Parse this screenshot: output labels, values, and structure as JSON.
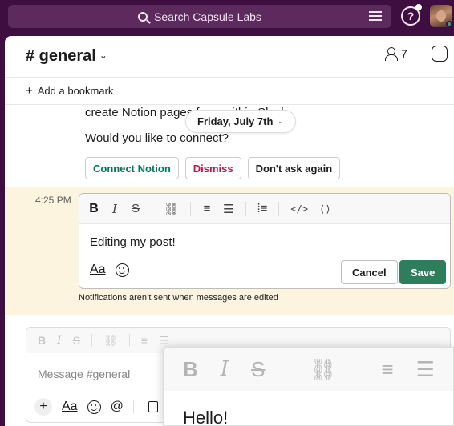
{
  "search": {
    "placeholder": "Search Capsule Labs"
  },
  "channel": {
    "name": "# general",
    "members_count": "7"
  },
  "bookmarks": {
    "add_label": "Add a bookmark"
  },
  "messages": {
    "line1": "create Notion pages from within Slack.",
    "line2": "Would you like to connect?",
    "date_divider": "Friday, July 7th",
    "actions": {
      "connect": "Connect Notion",
      "dismiss": "Dismiss",
      "dont_ask": "Don't ask again"
    }
  },
  "edit": {
    "timestamp": "4:25 PM",
    "text": "Editing my post!",
    "format_label": "Aa",
    "cancel_label": "Cancel",
    "save_label": "Save",
    "notice": "Notifications aren’t sent when messages are edited"
  },
  "toolbar": {
    "bold": "B",
    "italic": "I",
    "strike": "S",
    "link": "🔗",
    "ordered_list": "⁝☰",
    "bullet_list": "☰",
    "blockquote": "|☰",
    "code": "</>",
    "code_block": "⌨"
  },
  "composer": {
    "placeholder": "Message #general",
    "format_label": "Aa",
    "mention": "@"
  },
  "zoom": {
    "text": "Hello!"
  },
  "colors": {
    "aubergine": "#3f0e40",
    "save_green": "#2e7d5b",
    "edit_highlight": "#fcf4de"
  }
}
